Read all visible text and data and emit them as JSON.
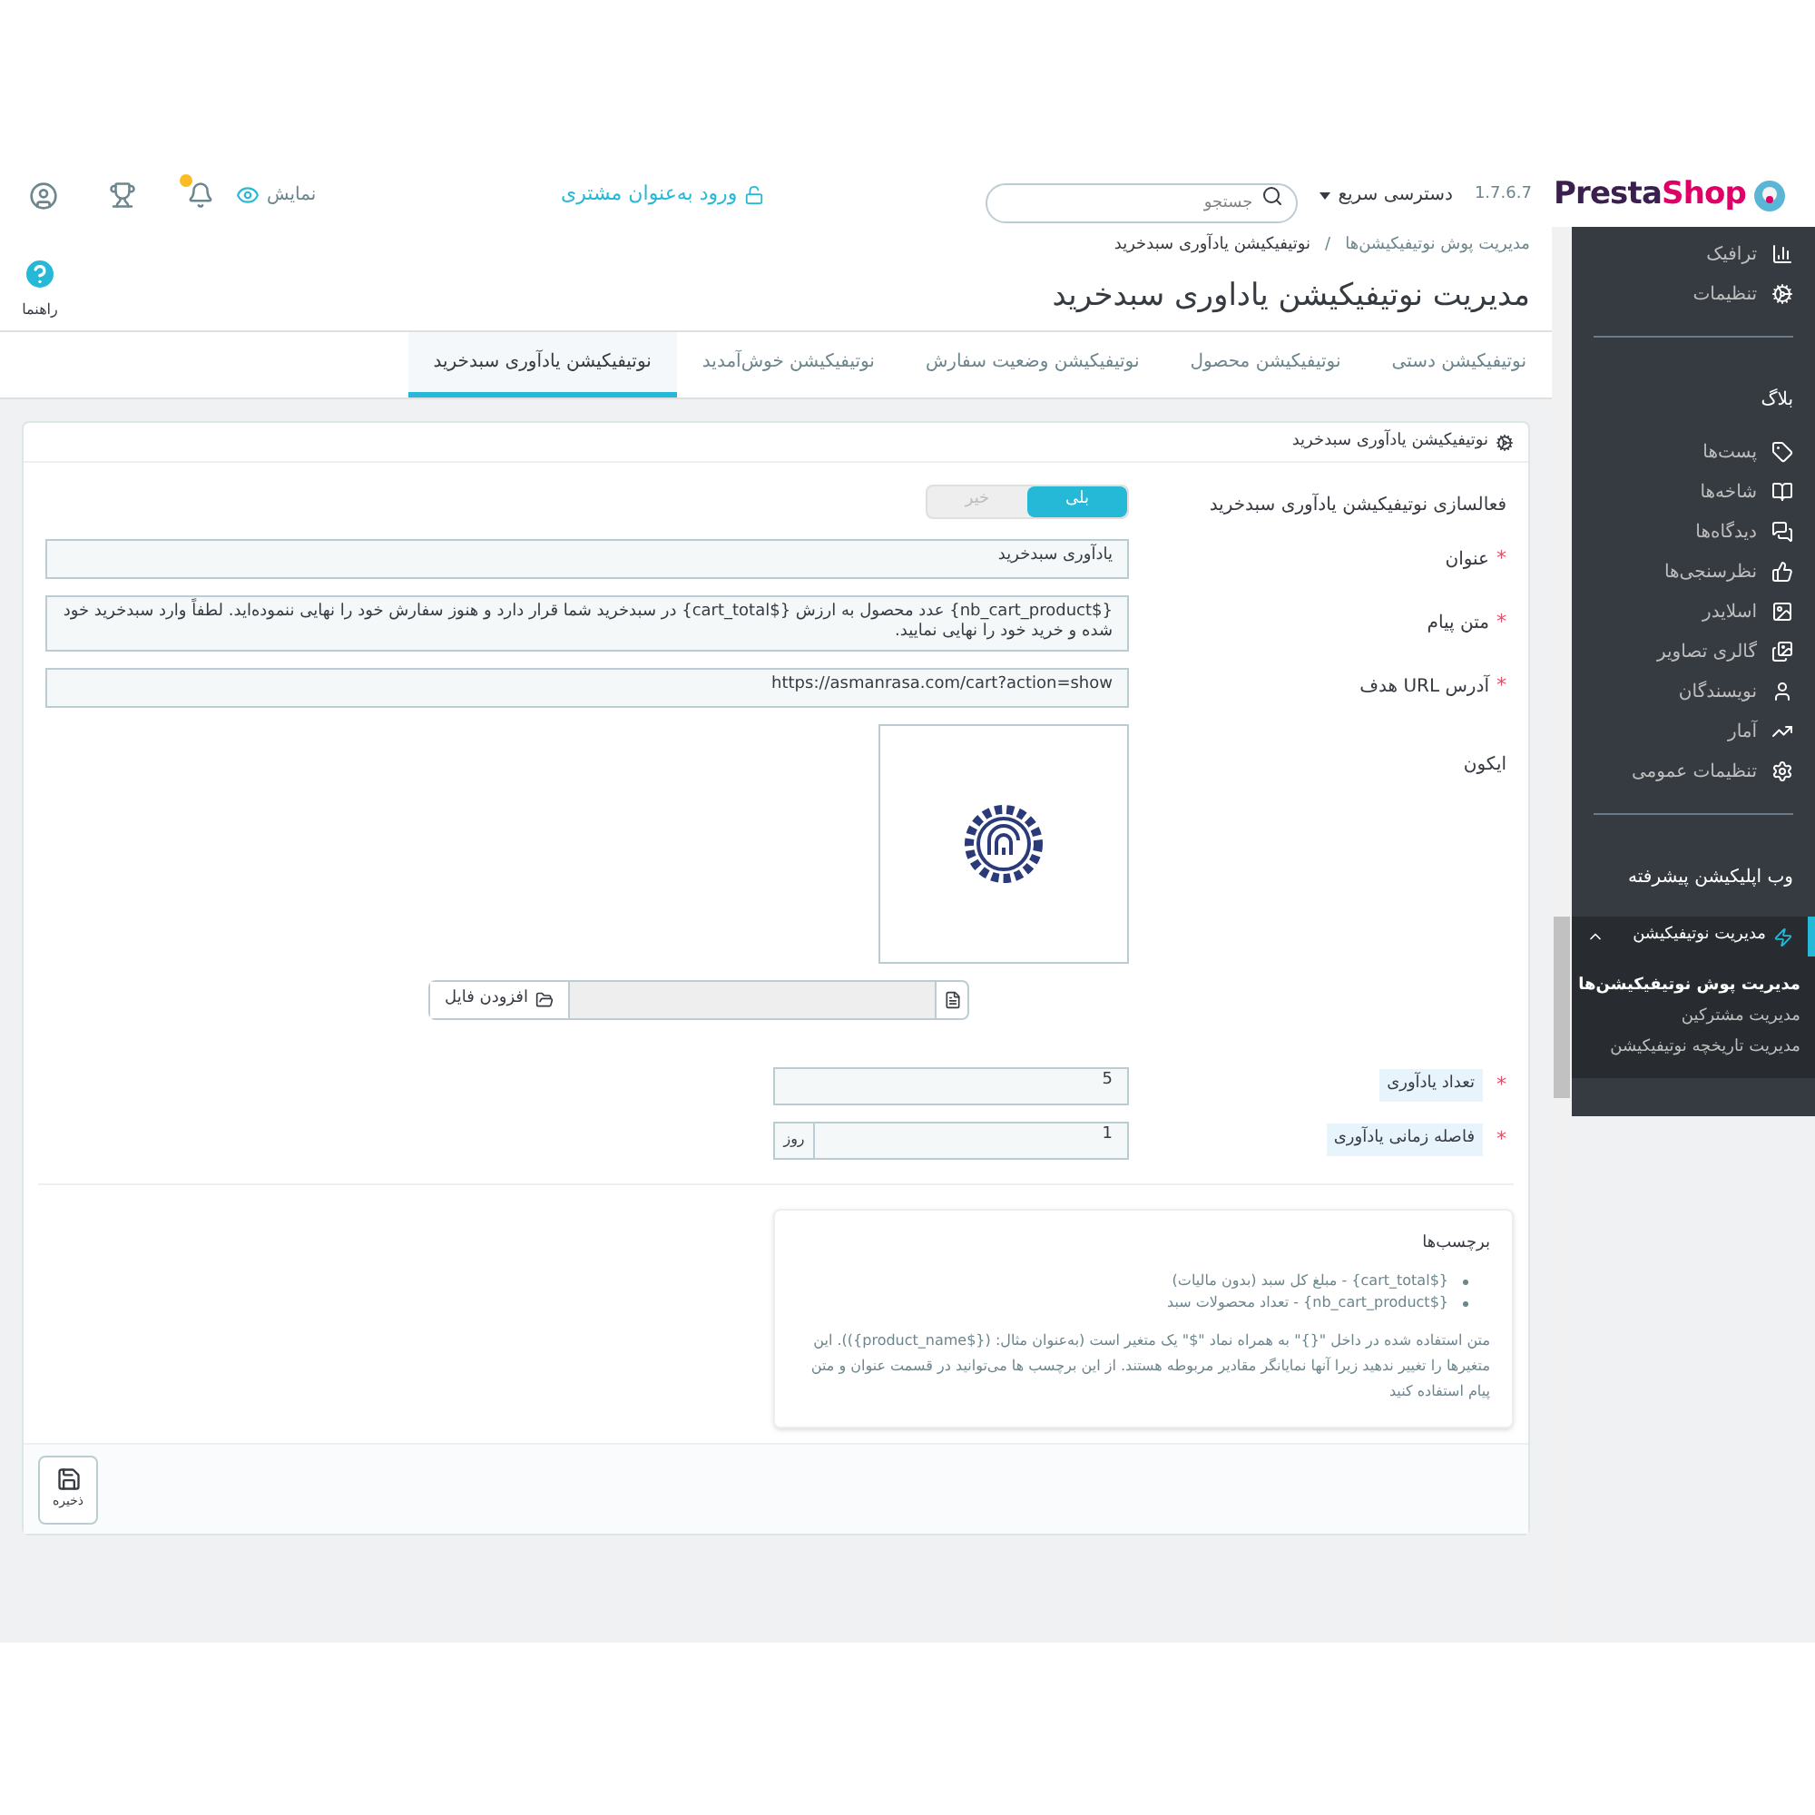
{
  "header": {
    "logo": {
      "part_1": "Presta",
      "part_2": "Shop"
    },
    "version": "1.7.6.7",
    "quick_access": "دسترسی سریع",
    "search": {
      "placeholder": "جستجو"
    },
    "login_as_customer": "ورود به‌عنوان مشتری",
    "view": "نمایش"
  },
  "sidebar": {
    "items": [
      {
        "kind": "item",
        "label": "ترافیک"
      },
      {
        "kind": "item",
        "label": "تنظیمات"
      },
      {
        "kind": "divider"
      },
      {
        "kind": "heading",
        "label": "بلاگ"
      },
      {
        "kind": "item",
        "label": "پست‌ها"
      },
      {
        "kind": "item",
        "label": "شاخه‌ها"
      },
      {
        "kind": "item",
        "label": "دیدگاه‌ها"
      },
      {
        "kind": "item",
        "label": "نظرسنجی‌ها"
      },
      {
        "kind": "item",
        "label": "اسلایدر"
      },
      {
        "kind": "item",
        "label": "گالری تصاویر"
      },
      {
        "kind": "item",
        "label": "نویسندگان"
      },
      {
        "kind": "item",
        "label": "آمار"
      },
      {
        "kind": "item",
        "label": "تنظیمات عمومی"
      },
      {
        "kind": "divider"
      },
      {
        "kind": "heading",
        "label": "وب اپلیکیشن پیشرفته"
      },
      {
        "kind": "group",
        "label": "مدیریت نوتیفیکیشن",
        "expanded": true,
        "children": [
          {
            "label": "مدیریت پوش نوتیفیکیشن‌ها",
            "selected": true
          },
          {
            "label": "مدیریت مشترکین",
            "selected": false
          },
          {
            "label": "مدیریت تاریخچه نوتیفیکیشن",
            "selected": false
          }
        ]
      }
    ]
  },
  "toolbar": {
    "breadcrumb": [
      "مدیریت پوش نوتیفیکیشن‌ها",
      "نوتیفیکیشن یادآوری سبدخرید"
    ],
    "breadcrumb_separator": "/",
    "title": "مدیریت نوتیفیکیشن یاداوری سبدخرید",
    "help": "راهنما"
  },
  "tabs": [
    {
      "label": "نوتیفیکیشن دستی",
      "selected": false
    },
    {
      "label": "نوتیفیکیشن محصول",
      "selected": false
    },
    {
      "label": "نوتیفیکیشن وضعیت سفارش",
      "selected": false
    },
    {
      "label": "نوتیفیکیشن خوش‌آمدید",
      "selected": false
    },
    {
      "label": "نوتیفیکیشن یادآوری سبدخرید",
      "selected": true
    }
  ],
  "panel": {
    "title": "نوتیفیکیشن یادآوری سبدخرید",
    "switch": {
      "label": "فعالسازی نوتیفیکیشن یادآوری سبدخرید",
      "options": [
        {
          "label": "بلی",
          "selected": true
        },
        {
          "label": "خیر",
          "selected": false
        }
      ]
    },
    "fields": [
      {
        "kind": "text",
        "label": "عنوان",
        "required_mark": "*",
        "value": "یادآوری سبدخرید"
      },
      {
        "kind": "text",
        "label": "متن پیام",
        "required_mark": "*",
        "value": "{$nb_cart_product} عدد محصول به ارزش {$cart_total} در سبدخرید شما قرار دارد و هنوز سفارش خود را نهایی ننموده‌اید. لطفاً وارد سبدخرید خود شده و خرید خود را نهایی نمایید."
      },
      {
        "kind": "url",
        "label": "آدرس URL هدف",
        "required_mark": "*",
        "value": "https://asmanrasa.com/cart?action=show"
      }
    ],
    "icon_label": "ایکون",
    "add_file": "افزودن فایل",
    "counters": [
      {
        "label": "تعداد یادآوری",
        "required_mark": "*",
        "value": "5"
      },
      {
        "label": "فاصله زمانی یادآوری",
        "required_mark": "*",
        "value": "1",
        "suffix": "روز"
      }
    ],
    "help": {
      "title": "برچسب‌ها",
      "bullets": [
        "{$cart_total} - مبلغ کل سبد (بدون مالیات)",
        "{$nb_cart_product} - تعداد محصولات سبد"
      ],
      "text": "متن استفاده شده در داخل \"{}\" به همراه نماد \"$\" یک متغیر است (به‌عنوان مثال: ({$product_name})). این متغیرها را تغییر ندهید زیرا آنها نمایانگر مقادیر مربوطه هستند. از این برچسب ها می‌توانید در قسمت عنوان و متن پیام استفاده کنید"
    },
    "save": "ذخیره"
  }
}
